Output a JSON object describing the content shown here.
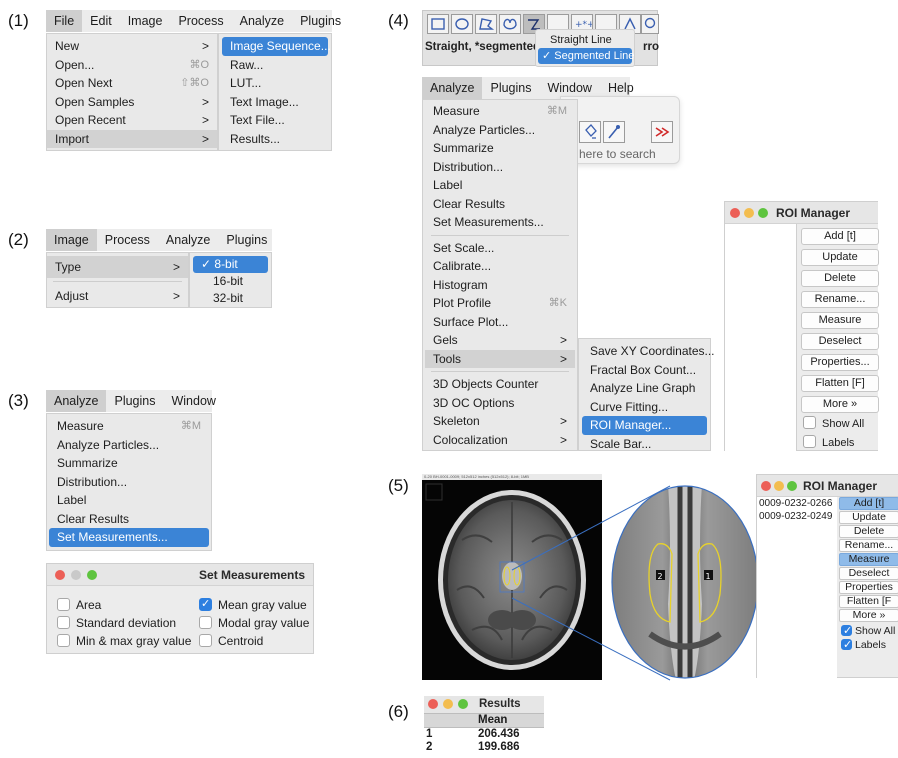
{
  "panels": {
    "p1": "(1)",
    "p2": "(2)",
    "p3": "(3)",
    "p4": "(4)",
    "p5": "(5)",
    "p6": "(6)"
  },
  "panel1": {
    "menubar": [
      "File",
      "Edit",
      "Image",
      "Process",
      "Analyze",
      "Plugins"
    ],
    "file_menu": [
      {
        "label": "New",
        "arrow": ">"
      },
      {
        "label": "Open...",
        "shortcut": "⌘O"
      },
      {
        "label": "Open Next",
        "shortcut": "⇧⌘O"
      },
      {
        "label": "Open Samples",
        "arrow": ">"
      },
      {
        "label": "Open Recent",
        "arrow": ">"
      },
      {
        "label": "Import",
        "arrow": ">"
      }
    ],
    "import_menu": [
      "Image Sequence...",
      "Raw...",
      "LUT...",
      "Text Image...",
      "Text File...",
      "Results..."
    ]
  },
  "panel2": {
    "menubar": [
      "Image",
      "Process",
      "Analyze",
      "Plugins"
    ],
    "image_menu": [
      {
        "label": "Type",
        "arrow": ">"
      },
      {
        "label": "Adjust",
        "arrow": ">"
      }
    ],
    "type_menu": [
      "✓ 8-bit",
      "16-bit",
      "32-bit"
    ]
  },
  "panel3": {
    "menubar": [
      "Analyze",
      "Plugins",
      "Window"
    ],
    "analyze_menu": [
      {
        "label": "Measure",
        "shortcut": "⌘M"
      },
      {
        "label": "Analyze Particles..."
      },
      {
        "label": "Summarize"
      },
      {
        "label": "Distribution..."
      },
      {
        "label": "Label"
      },
      {
        "label": "Clear Results"
      },
      {
        "label": "Set Measurements..."
      }
    ],
    "dialog_title": "Set Measurements",
    "checkboxes": [
      {
        "label": "Area",
        "checked": false
      },
      {
        "label": "Mean gray value",
        "checked": true
      },
      {
        "label": "Standard deviation",
        "checked": false
      },
      {
        "label": "Modal gray value",
        "checked": false
      },
      {
        "label": "Min & max gray value",
        "checked": false
      },
      {
        "label": "Centroid",
        "checked": false
      }
    ]
  },
  "panel4": {
    "toolbar_status": "Straight, *segmented*",
    "toolbar_status_trail": "rro",
    "line_popup": [
      "Straight Line",
      "✓ Segmented Line"
    ],
    "menubar": [
      "Analyze",
      "Plugins",
      "Window",
      "Help"
    ],
    "search_hint": "here to search",
    "analyze_menu": [
      {
        "label": "Measure",
        "shortcut": "⌘M"
      },
      {
        "label": "Analyze Particles..."
      },
      {
        "label": "Summarize"
      },
      {
        "label": "Distribution..."
      },
      {
        "label": "Label"
      },
      {
        "label": "Clear Results"
      },
      {
        "label": "Set Measurements..."
      },
      {
        "sep": true
      },
      {
        "label": "Set Scale..."
      },
      {
        "label": "Calibrate..."
      },
      {
        "label": "Histogram"
      },
      {
        "label": "Plot Profile",
        "shortcut": "⌘K"
      },
      {
        "label": "Surface Plot..."
      },
      {
        "label": "Gels",
        "arrow": ">"
      },
      {
        "label": "Tools",
        "arrow": ">"
      },
      {
        "sep": true
      },
      {
        "label": "3D Objects Counter"
      },
      {
        "label": "3D OC Options"
      },
      {
        "label": "Skeleton",
        "arrow": ">"
      },
      {
        "label": "Colocalization",
        "arrow": ">"
      }
    ],
    "tools_menu": [
      "Save XY Coordinates...",
      "Fractal Box Count...",
      "Analyze Line Graph",
      "Curve Fitting...",
      "ROI Manager...",
      "Scale Bar..."
    ],
    "roi_title": "ROI Manager",
    "roi_buttons": [
      "Add [t]",
      "Update",
      "Delete",
      "Rename...",
      "Measure",
      "Deselect",
      "Properties...",
      "Flatten [F]",
      "More »"
    ],
    "roi_checks": [
      {
        "label": "Show All",
        "checked": false
      },
      {
        "label": "Labels",
        "checked": false
      }
    ]
  },
  "panel5": {
    "image_header": "0-20 BH-0001-0009; 512x512 inches (512x512); 8-bit; 1MB",
    "roi_labels": [
      "2",
      "1"
    ],
    "roi_title": "ROI Manager",
    "roi_list": [
      "0009-0232-0266",
      "0009-0232-0249"
    ],
    "roi_buttons": [
      "Add [t]",
      "Update",
      "Delete",
      "Rename...",
      "Measure",
      "Deselect",
      "Properties",
      "Flatten [F",
      "More »"
    ],
    "roi_checks": [
      {
        "label": "Show All",
        "checked": true
      },
      {
        "label": "Labels",
        "checked": true
      }
    ]
  },
  "panel6": {
    "title": "Results",
    "column": "Mean",
    "rows": [
      {
        "n": "1",
        "mean": "206.436"
      },
      {
        "n": "2",
        "mean": "199.686"
      }
    ]
  },
  "colors": {
    "selection": "#3b84d6",
    "menu_bg": "#e9e9e9",
    "highlight": "#d2d2d2",
    "roi_yellow": "#e8d22a"
  }
}
